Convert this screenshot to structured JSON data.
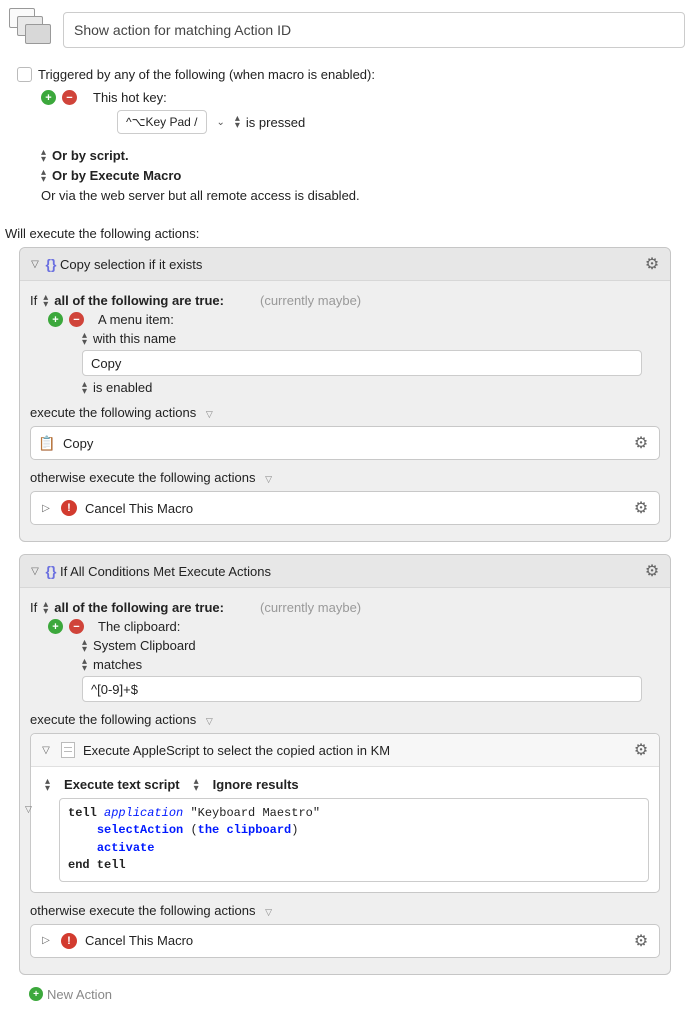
{
  "header": {
    "title": "Show action for matching Action ID"
  },
  "trigger": {
    "checkbox_label": "Triggered by any of the following (when macro is enabled):",
    "hotkey_label": "This hot key:",
    "hotkey_value": "^⌥Key Pad /",
    "hotkey_state": "is pressed",
    "or_script": "Or by script.",
    "or_execute": "Or by Execute Macro",
    "or_web": "Or via the web server but all remote access is disabled."
  },
  "exec_heading": "Will execute the following actions:",
  "action1": {
    "title": "Copy selection if it exists",
    "if_label": "If",
    "if_mode": "all of the following are true:",
    "currently": "(currently maybe)",
    "cond_label": "A menu item:",
    "match_mode": "with this name",
    "match_value": "Copy",
    "state": "is enabled",
    "exec_label": "execute the following actions",
    "sub_copy": "Copy",
    "otherwise_label": "otherwise execute the following actions",
    "cancel": "Cancel This Macro"
  },
  "action2": {
    "title": "If All Conditions Met Execute Actions",
    "if_label": "If",
    "if_mode": "all of the following are true:",
    "currently": "(currently maybe)",
    "cond_label": "The clipboard:",
    "clipboard_src": "System Clipboard",
    "match_mode": "matches",
    "match_value": "^[0-9]+$",
    "exec_label": "execute the following actions",
    "sub_title": "Execute AppleScript to select the copied action in KM",
    "opt1": "Execute text script",
    "opt2": "Ignore results",
    "script": {
      "l1a": "tell",
      "l1b": "application",
      "l1c": "\"Keyboard Maestro\"",
      "l2a": "selectAction",
      "l2b": "(",
      "l2c": "the clipboard",
      "l2d": ")",
      "l3": "activate",
      "l4": "end tell"
    },
    "otherwise_label": "otherwise execute the following actions",
    "cancel": "Cancel This Macro"
  },
  "footer": {
    "new_action": "New Action"
  }
}
